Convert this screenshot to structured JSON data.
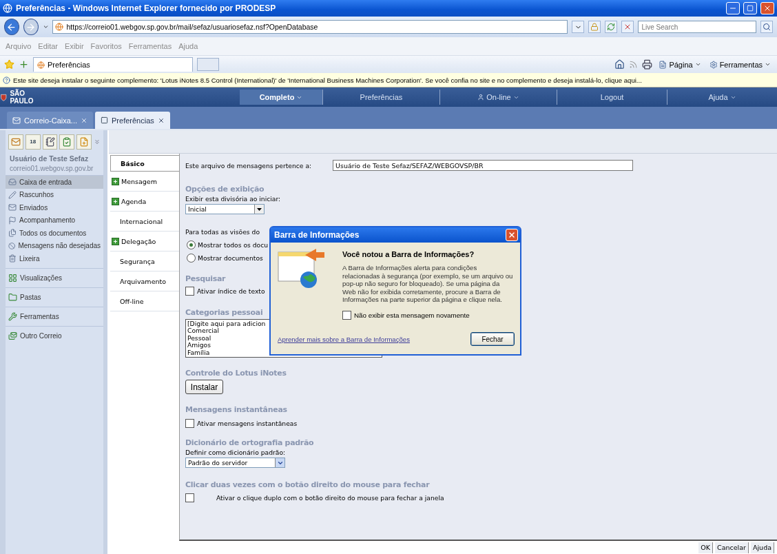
{
  "window": {
    "title": "Preferências - Windows Internet Explorer fornecido por PRODESP"
  },
  "address_bar": {
    "url": "https://correio01.webgov.sp.gov.br/mail/sefaz/usuariosefaz.nsf?OpenDatabase",
    "search_placeholder": "Live Search"
  },
  "menu_bar": [
    {
      "label": "Arquivo"
    },
    {
      "label": "Editar"
    },
    {
      "label": "Exibir"
    },
    {
      "label": "Favoritos"
    },
    {
      "label": "Ferramentas"
    },
    {
      "label": "Ajuda"
    }
  ],
  "browser_tabs": [
    {
      "label": "Preferências",
      "selected": true
    }
  ],
  "command_bar": [
    {
      "label": "Página"
    },
    {
      "label": "Ferramentas"
    }
  ],
  "info_bar": {
    "text": "Este site deseja instalar o seguinte complemento: 'Lotus iNotes 8.5 Control (International)' de 'International Business Machines Corporation'. Se você confia no site e no complemento e deseja instalá-lo, clique aqui..."
  },
  "app_header": {
    "logo": "SÃO PAULO",
    "nav": [
      {
        "label": "Completo",
        "kind": "menu",
        "selected": true
      },
      {
        "label": "Preferências",
        "kind": "link",
        "selected": false
      },
      {
        "label": "On-line",
        "kind": "status",
        "selected": false
      },
      {
        "label": "Logout",
        "kind": "link",
        "selected": false
      },
      {
        "label": "Ajuda",
        "kind": "menu",
        "selected": false
      }
    ]
  },
  "app_tabs": [
    {
      "label": "Correio-Caixa...",
      "selected": false
    },
    {
      "label": "Preferências",
      "selected": true
    }
  ],
  "sidebar": {
    "calendar_day": "18",
    "user_name": "Usuário de Teste Sefaz",
    "server": "correio01.webgov.sp.gov.br",
    "folders": [
      {
        "label": "Caixa de entrada",
        "selected": true
      },
      {
        "label": "Rascunhos",
        "selected": false
      },
      {
        "label": "Enviados",
        "selected": false
      },
      {
        "label": "Acompanhamento",
        "selected": false
      },
      {
        "label": "Todos os documentos",
        "selected": false
      },
      {
        "label": "Mensagens não desejadas",
        "selected": false
      },
      {
        "label": "Lixeira",
        "selected": false
      }
    ],
    "sections": [
      {
        "label": "Visualizações"
      },
      {
        "label": "Pastas"
      },
      {
        "label": "Ferramentas"
      },
      {
        "label": "Outro Correio"
      }
    ]
  },
  "preference_tabs": [
    {
      "label": "Básico",
      "selected": true,
      "expandable": false
    },
    {
      "label": "Mensagem",
      "selected": false,
      "expandable": true
    },
    {
      "label": "Agenda",
      "selected": false,
      "expandable": true
    },
    {
      "label": "Internacional",
      "selected": false,
      "expandable": false
    },
    {
      "label": "Delegação",
      "selected": false,
      "expandable": true
    },
    {
      "label": "Segurança",
      "selected": false,
      "expandable": false
    },
    {
      "label": "Arquivamento",
      "selected": false,
      "expandable": false
    },
    {
      "label": "Off-line",
      "selected": false,
      "expandable": false
    }
  ],
  "form": {
    "owner_label": "Este arquivo de mensagens pertence a:",
    "owner_value": "Usuário de Teste Sefaz/SEFAZ/WEBGOVSP/BR",
    "display_heading": "Opções de exibição",
    "startup_label": "Exibir esta divisória ao iniciar:",
    "startup_value": "Inicial",
    "views_label": "Para todas as visões do",
    "view_options": [
      {
        "label": "Mostrar todos os docu",
        "selected": true
      },
      {
        "label": "Mostrar documentos",
        "selected": false
      }
    ],
    "search_heading": "Pesquisar",
    "search_index": {
      "label": "Ativar índice de texto",
      "checked": false
    },
    "categories_heading": "Categorias pessoai",
    "categories": [
      "[Digite aqui para adicion",
      "Comercial",
      "Pessoal",
      "Amigos",
      "Família"
    ],
    "control_heading": "Controle do Lotus iNotes",
    "install_button": "Instalar",
    "im_heading": "Mensagens instantâneas",
    "im_option": {
      "label": "Ativar mensagens instantâneas",
      "checked": false
    },
    "dictionary_heading": "Dicionário de ortografia padrão",
    "dictionary_label": "Definir como dicionário padrão:",
    "dictionary_value": "Padrão do servidor",
    "close_heading": "Clicar duas vezes com o botão direito do mouse para fechar",
    "close_option": {
      "label": "Ativar o clique duplo com o botão direito do mouse para fechar a janela",
      "checked": false
    }
  },
  "dialog": {
    "title": "Barra de Informações",
    "heading": "Você notou a Barra de Informações?",
    "body": "A Barra de Informações alerta para condições relacionadas à segurança (por exemplo, se um arquivo ou pop-up não seguro for bloqueado). Se uma página da Web não for exibida corretamente, procure a Barra de Informações na parte superior da página e clique nela.",
    "dont_show": {
      "label": "Não exibir esta mensagem novamente",
      "checked": false
    },
    "link": "Aprender mais sobre a Barra de Informações",
    "button": "Fechar"
  },
  "footer_buttons": [
    {
      "label": "OK"
    },
    {
      "label": "Cancelar"
    },
    {
      "label": "Ajuda"
    }
  ]
}
